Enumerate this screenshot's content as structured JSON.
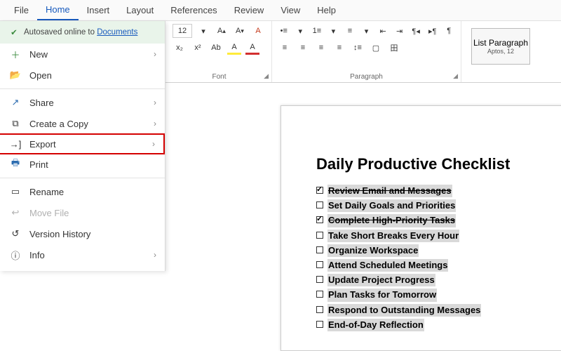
{
  "tabs": {
    "file": "File",
    "home": "Home",
    "insert": "Insert",
    "layout": "Layout",
    "references": "References",
    "review": "Review",
    "view": "View",
    "help": "Help"
  },
  "autosave": {
    "prefix": "Autosaved online to ",
    "link": "Documents"
  },
  "menu": {
    "new": "New",
    "open": "Open",
    "share": "Share",
    "copy": "Create a Copy",
    "export": "Export",
    "print": "Print",
    "rename": "Rename",
    "move": "Move File",
    "history": "Version History",
    "info": "Info"
  },
  "font": {
    "size": "12",
    "label": "Font"
  },
  "paragraph": {
    "label": "Paragraph"
  },
  "style": {
    "name": "List Paragraph",
    "detail": "Aptos, 12"
  },
  "doc": {
    "title": "Daily Productive Checklist",
    "items": [
      {
        "t": "Review Email and Messages",
        "c": true
      },
      {
        "t": "Set Daily Goals and Priorities",
        "c": false
      },
      {
        "t": "Complete High-Priority Tasks",
        "c": true
      },
      {
        "t": "Take Short Breaks Every Hour",
        "c": false
      },
      {
        "t": "Organize Workspace",
        "c": false
      },
      {
        "t": "Attend Scheduled Meetings",
        "c": false
      },
      {
        "t": "Update Project Progress",
        "c": false
      },
      {
        "t": " Plan Tasks for Tomorrow",
        "c": false
      },
      {
        "t": "Respond to Outstanding Messages",
        "c": false
      },
      {
        "t": "End-of-Day Reflection",
        "c": false
      }
    ]
  }
}
